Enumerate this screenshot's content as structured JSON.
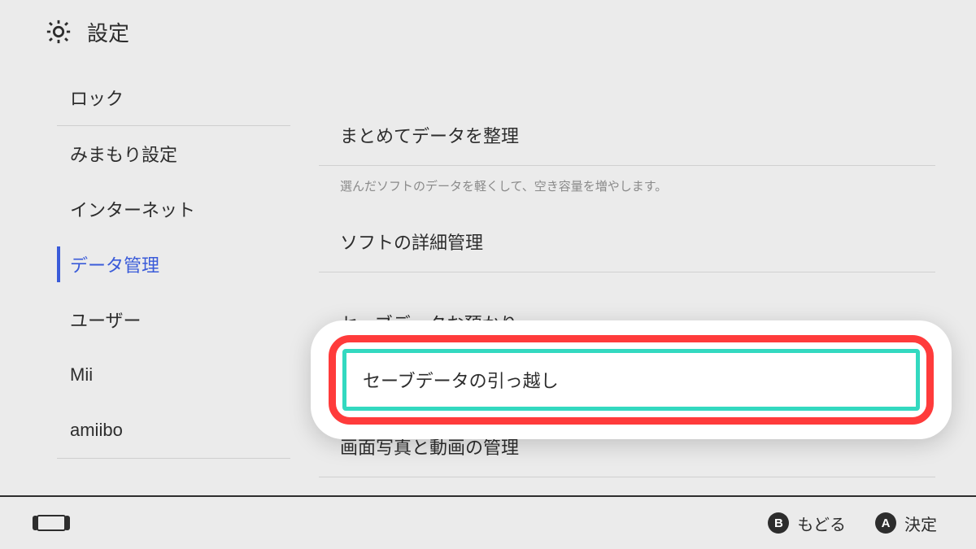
{
  "header": {
    "title": "設定"
  },
  "sidebar": {
    "items": [
      {
        "label": "ロック"
      },
      {
        "label": "みまもり設定"
      },
      {
        "label": "インターネット"
      },
      {
        "label": "データ管理"
      },
      {
        "label": "ユーザー"
      },
      {
        "label": "Mii"
      },
      {
        "label": "amiibo"
      }
    ],
    "active_index": 3
  },
  "main": {
    "rows": [
      {
        "label": "まとめてデータを整理",
        "desc": "選んだソフトのデータを軽くして、空き容量を増やします。"
      },
      {
        "label": "ソフトの詳細管理"
      },
      {
        "label": "セーブデータお預かり"
      },
      {
        "label": "セーブデータの引っ越し"
      },
      {
        "label": "画面写真と動画の管理"
      }
    ]
  },
  "footer": {
    "back_glyph": "B",
    "back_label": "もどる",
    "ok_glyph": "A",
    "ok_label": "決定"
  }
}
